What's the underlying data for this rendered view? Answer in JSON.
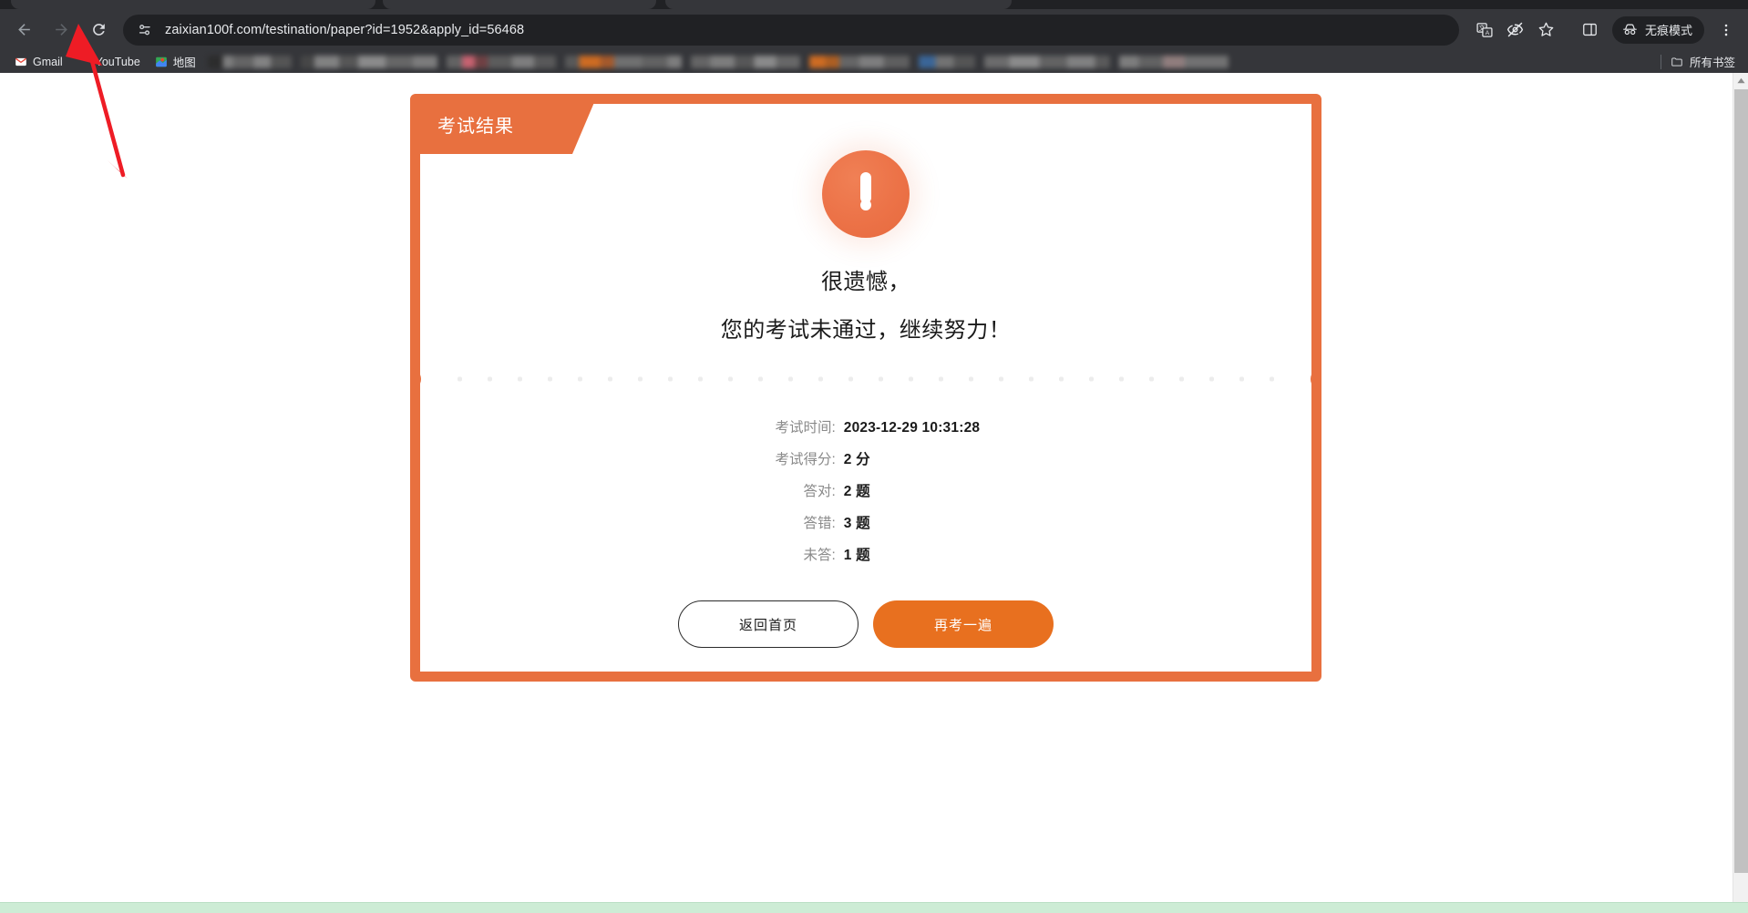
{
  "browser": {
    "url": "zaixian100f.com/testination/paper?id=1952&apply_id=56468",
    "back_icon": "back-arrow-icon",
    "forward_icon": "forward-arrow-icon",
    "reload_icon": "reload-icon",
    "site_info_icon": "site-settings-icon",
    "translate_icon": "translate-icon",
    "tracking_icon": "eye-slash-icon",
    "bookmark_icon": "star-icon",
    "side_panel_icon": "side-panel-icon",
    "incognito_label": "无痕模式",
    "incognito_icon": "incognito-hat-icon",
    "menu_icon": "three-dot-menu-icon",
    "bookmarks": [
      {
        "label": "Gmail",
        "icon": "gmail-icon"
      },
      {
        "label": "YouTube",
        "icon": "youtube-icon"
      },
      {
        "label": "地图",
        "icon": "google-maps-icon"
      }
    ],
    "all_bookmarks_label": "所有书签",
    "all_bookmarks_icon": "folder-icon"
  },
  "page": {
    "ribbon_title": "考试结果",
    "status_icon": "exclamation-circle-icon",
    "message_line1": "很遗憾，",
    "message_line2": "您的考试未通过，继续努力！",
    "stats": [
      {
        "label": "考试时间:",
        "value": "2023-12-29 10:31:28"
      },
      {
        "label": "考试得分:",
        "value": "2 分"
      },
      {
        "label": "答对:",
        "value": "2 题"
      },
      {
        "label": "答错:",
        "value": "3 题"
      },
      {
        "label": "未答:",
        "value": "1 题"
      }
    ],
    "buttons": {
      "secondary": "返回首页",
      "primary": "再考一遍"
    },
    "colors": {
      "accent": "#e8703f",
      "primary_button": "#e8701f",
      "text": "#1b1b1b",
      "muted_text": "#8a8a8a"
    }
  },
  "annotation": {
    "arrow_color": "#ee1c25",
    "arrow_target": "reload-icon"
  }
}
